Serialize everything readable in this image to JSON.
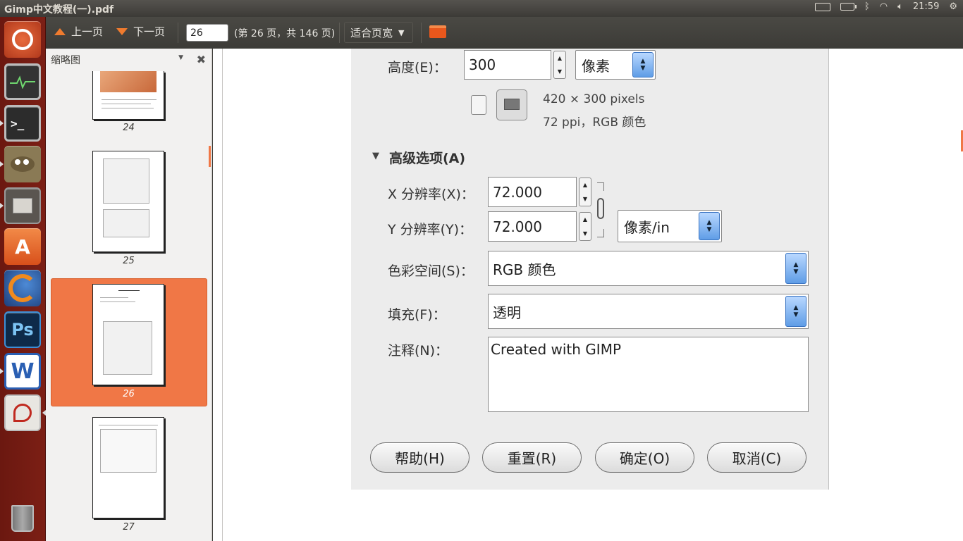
{
  "window": {
    "title": "Gimp中文教程(一).pdf"
  },
  "panel": {
    "clock": "21:59"
  },
  "launcher": {
    "items": [
      {
        "name": "ubuntu-dash-icon"
      },
      {
        "name": "system-monitor-icon"
      },
      {
        "name": "terminal-icon"
      },
      {
        "name": "gimp-icon"
      },
      {
        "name": "file-manager-icon"
      },
      {
        "name": "software-center-icon"
      },
      {
        "name": "firefox-icon"
      },
      {
        "name": "photoshop-icon",
        "label": "Ps"
      },
      {
        "name": "wps-writer-icon",
        "label": "W"
      },
      {
        "name": "document-viewer-icon"
      },
      {
        "name": "trash-icon"
      }
    ]
  },
  "toolbar": {
    "prev_label": "上一页",
    "next_label": "下一页",
    "page_value": "26",
    "page_info": "(第 26 页，共 146 页)",
    "zoom_label": "适合页宽"
  },
  "sidebar": {
    "title": "缩略图",
    "thumbnails": [
      {
        "page": "24"
      },
      {
        "page": "25"
      },
      {
        "page": "26",
        "selected": true
      },
      {
        "page": "27"
      }
    ]
  },
  "dialog": {
    "height_label": "高度(E)：",
    "height_value": "300",
    "unit_pixels": "像素",
    "image_size": "420 × 300 pixels",
    "image_res": "72 ppi，RGB 颜色",
    "advanced_label": "高级选项(A)",
    "x_res_label": "X 分辨率(X)：",
    "x_res_value": "72.000",
    "y_res_label": "Y 分辨率(Y)：",
    "y_res_value": "72.000",
    "res_unit": "像素/in",
    "colorspace_label": "色彩空间(S)：",
    "colorspace_value": "RGB 颜色",
    "fill_label": "填充(F)：",
    "fill_value": "透明",
    "comment_label": "注释(N)：",
    "comment_value": "Created with GIMP",
    "buttons": {
      "help": "帮助(H)",
      "reset": "重置(R)",
      "ok": "确定(O)",
      "cancel": "取消(C)"
    }
  }
}
